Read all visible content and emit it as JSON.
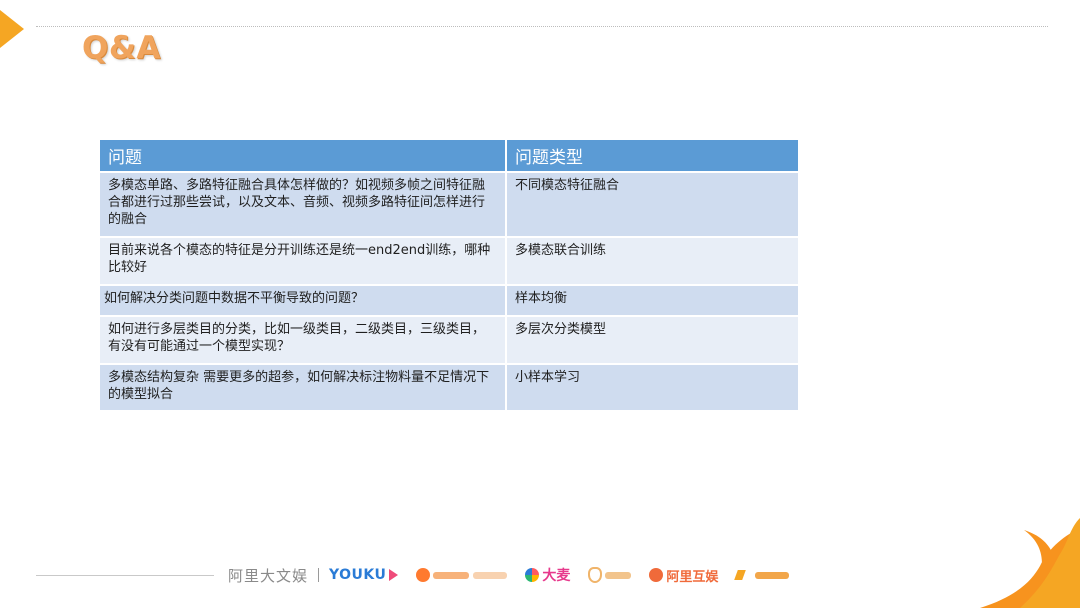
{
  "slide": {
    "title": "Q&A"
  },
  "table": {
    "headers": [
      "问题",
      "问题类型"
    ],
    "rows": [
      {
        "question": "多模态单路、多路特征融合具体怎样做的？如视频多帧之间特征融合都进行过那些尝试，以及文本、音频、视频多路特征间怎样进行的融合",
        "type": "不同模态特征融合"
      },
      {
        "question": "目前来说各个模态的特征是分开训练还是统一end2end训练，哪种比较好",
        "type": "多模态联合训练"
      },
      {
        "question": "如何解决分类问题中数据不平衡导致的问题？",
        "type": "样本均衡"
      },
      {
        "question": "如何进行多层类目的分类，比如一级类目，二级类目，三级类目，有没有可能通过一个模型实现？",
        "type": "多层次分类模型"
      },
      {
        "question": "多模态结构复杂 需要更多的超参，如何解决标注物料量不足情况下的模型拟合",
        "type": "小样本学习"
      }
    ]
  },
  "footer": {
    "brand_main": "阿里大文娱",
    "brand_youku": "YOUKU",
    "brand_damai": "大麦",
    "brand_hujing": "阿里互娱"
  },
  "colors": {
    "accent_orange": "#f5a623",
    "title_orange": "#f0a45d",
    "header_blue": "#5b9bd5",
    "row_dark": "#cfdcef",
    "row_light": "#e8eef7"
  }
}
